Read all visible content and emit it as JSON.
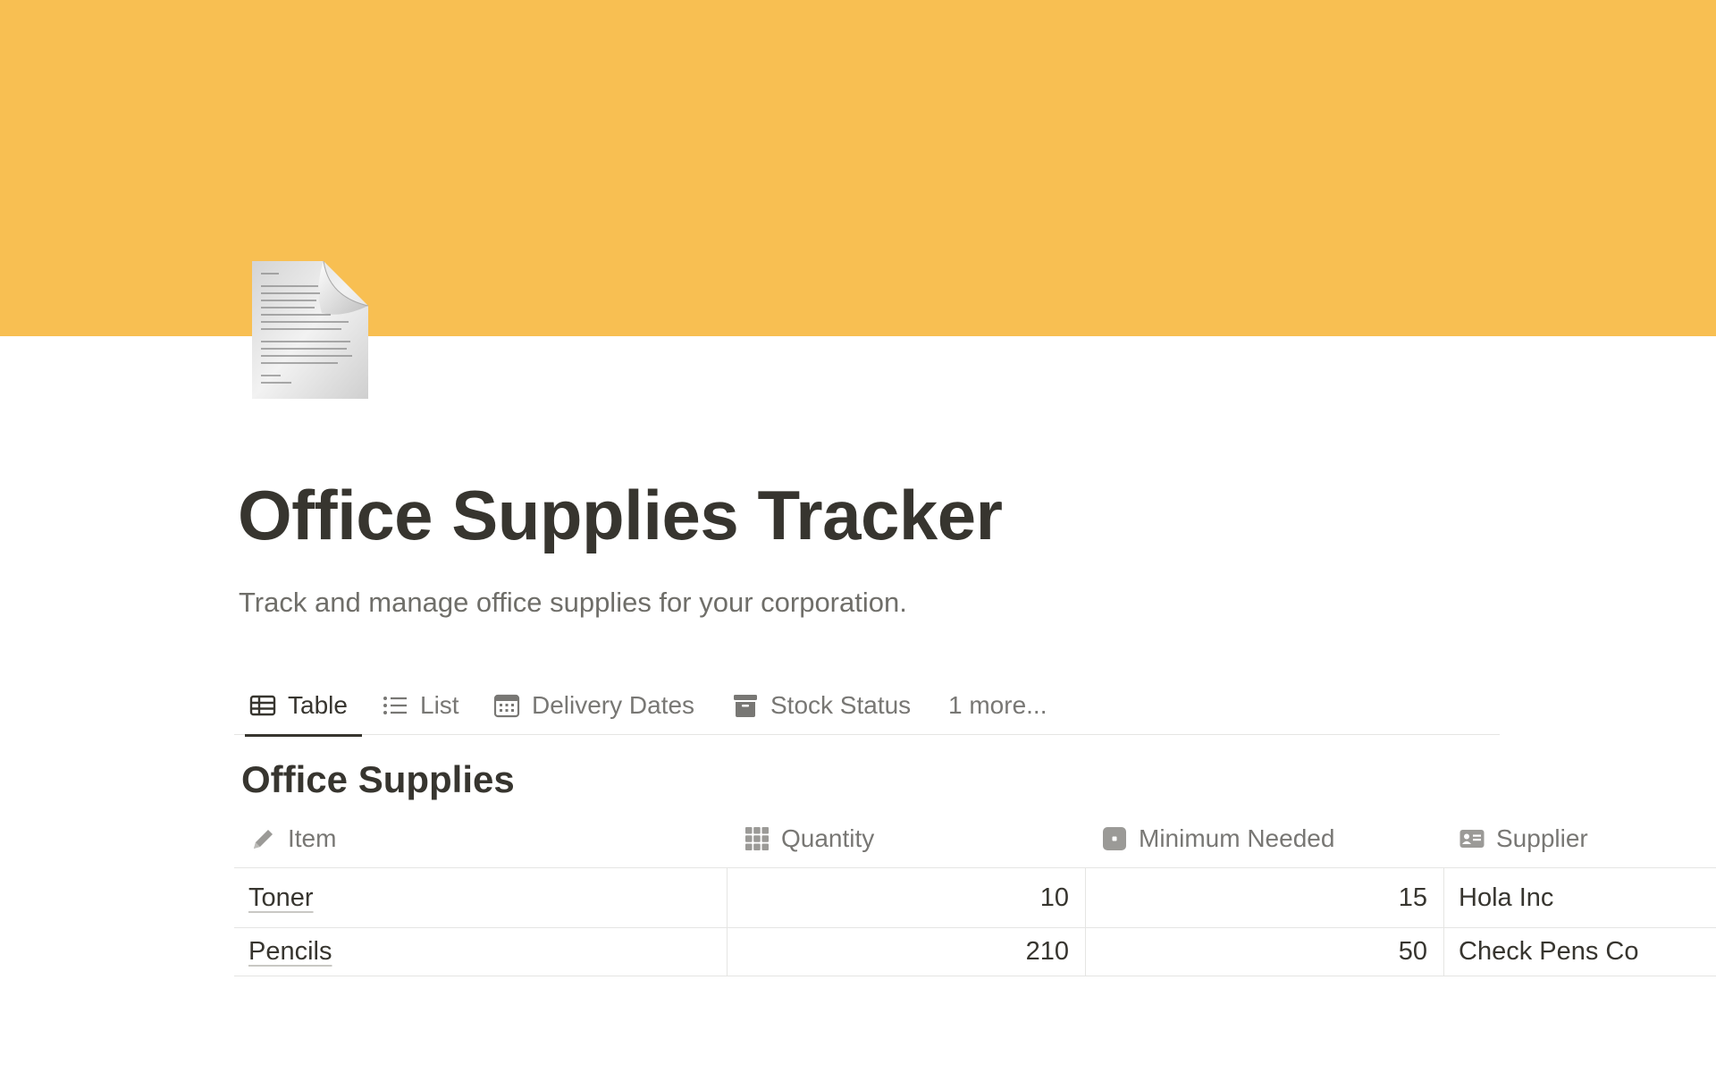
{
  "page": {
    "cover_color": "#F8BF52",
    "icon": "page-with-curl-icon",
    "title": "Office Supplies Tracker",
    "description": "Track and manage office supplies for your corporation."
  },
  "views": {
    "tabs": [
      {
        "label": "Table",
        "icon": "table-icon",
        "active": true
      },
      {
        "label": "List",
        "icon": "list-icon",
        "active": false
      },
      {
        "label": "Delivery Dates",
        "icon": "calendar-icon",
        "active": false
      },
      {
        "label": "Stock Status",
        "icon": "board-icon",
        "active": false
      }
    ],
    "more_label": "1 more..."
  },
  "database": {
    "title": "Office Supplies",
    "columns": [
      {
        "label": "Item",
        "icon": "pencil-icon"
      },
      {
        "label": "Quantity",
        "icon": "number-grid-icon"
      },
      {
        "label": "Minimum Needed",
        "icon": "formula-icon"
      },
      {
        "label": "Supplier",
        "icon": "contact-card-icon"
      }
    ],
    "rows": [
      {
        "item": "Toner",
        "quantity": "10",
        "minimum": "15",
        "supplier": "Hola Inc"
      },
      {
        "item": "Pencils",
        "quantity": "210",
        "minimum": "50",
        "supplier": "Check Pens Co"
      }
    ]
  }
}
